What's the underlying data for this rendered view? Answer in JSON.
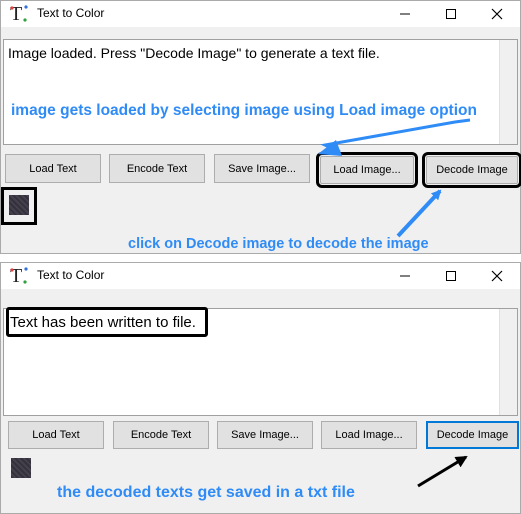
{
  "windows": [
    {
      "title": "Text to Color",
      "status": "Image loaded.  Press \"Decode Image\" to generate a text file.",
      "buttons": {
        "load_text": "Load Text",
        "encode_text": "Encode Text",
        "save_image": "Save Image...",
        "load_image": "Load Image...",
        "decode_image": "Decode Image"
      }
    },
    {
      "title": "Text to Color",
      "status": "Text has been written to file.",
      "buttons": {
        "load_text": "Load Text",
        "encode_text": "Encode Text",
        "save_image": "Save Image...",
        "load_image": "Load Image...",
        "decode_image": "Decode Image"
      }
    }
  ],
  "annotations": {
    "load_note": "image gets loaded by selecting image using Load image option",
    "decode_note": "click on Decode image to decode the image",
    "saved_note": "the decoded texts get saved in a txt file"
  },
  "colors": {
    "annotation_text": "#2f8bf6",
    "arrow_blue": "#2f8bf6",
    "arrow_black": "#000000",
    "highlight": "#000000"
  }
}
